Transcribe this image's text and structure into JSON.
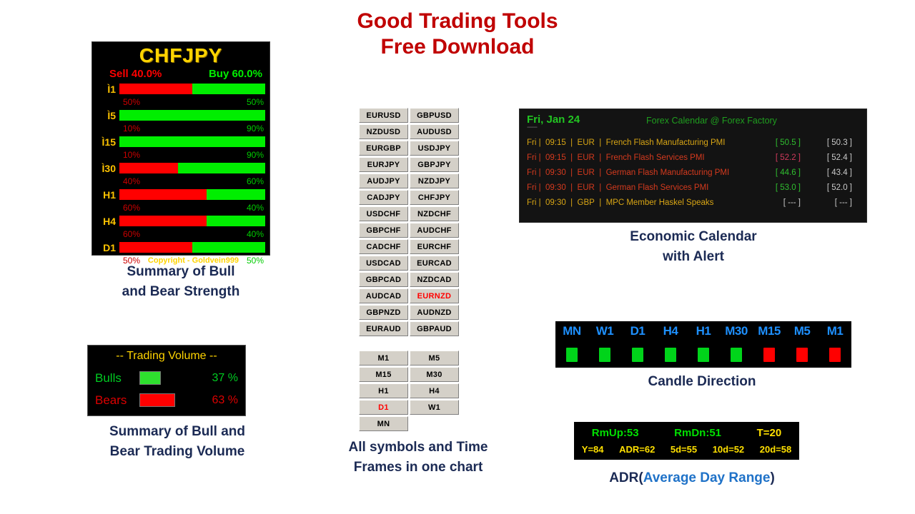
{
  "title": {
    "line1": "Good Trading Tools",
    "line2": "Free Download",
    "color": "#c00000"
  },
  "strength_panel": {
    "symbol": "CHFJPY",
    "sell_header": "Sell 40.0%",
    "buy_header": "Buy 60.0%",
    "copyright": "Copyright - Goldvein999",
    "sell_color": "#ff0000",
    "buy_color": "#00ee00",
    "rows": [
      {
        "timeframe": "Ì1",
        "sell_pct": "50%",
        "buy_pct": "50%",
        "sell_width": 50,
        "buy_width": 50
      },
      {
        "timeframe": "Ì5",
        "sell_pct": "10%",
        "buy_pct": "90%",
        "sell_width": 0,
        "buy_width": 100
      },
      {
        "timeframe": "Ì15",
        "sell_pct": "10%",
        "buy_pct": "90%",
        "sell_width": 0,
        "buy_width": 100
      },
      {
        "timeframe": "Ì30",
        "sell_pct": "40%",
        "buy_pct": "60%",
        "sell_width": 40,
        "buy_width": 60
      },
      {
        "timeframe": "H1",
        "sell_pct": "60%",
        "buy_pct": "40%",
        "sell_width": 60,
        "buy_width": 40
      },
      {
        "timeframe": "H4",
        "sell_pct": "60%",
        "buy_pct": "40%",
        "sell_width": 60,
        "buy_width": 40
      },
      {
        "timeframe": "D1",
        "sell_pct": "50%",
        "buy_pct": "50%",
        "sell_width": 50,
        "buy_width": 50
      }
    ],
    "footer_left": "50%",
    "footer_right": "50%",
    "caption_line1": "Summary of Bull",
    "caption_line2": "and Bear Strength"
  },
  "volume_panel": {
    "title": "-- Trading Volume --",
    "bulls_label": "Bulls",
    "bulls_pct": "37 %",
    "bulls_bar_width": 37,
    "bulls_color": "#2ee02e",
    "bears_label": "Bears",
    "bears_pct": "63 %",
    "bears_bar_width": 63,
    "bears_color": "#ff0000",
    "caption_line1": "Summary of Bull and",
    "caption_line2": "Bear Trading Volume"
  },
  "symbols_grid": {
    "rows": [
      [
        "EURUSD",
        "GBPUSD"
      ],
      [
        "NZDUSD",
        "AUDUSD"
      ],
      [
        "EURGBP",
        "USDJPY"
      ],
      [
        "EURJPY",
        "GBPJPY"
      ],
      [
        "AUDJPY",
        "NZDJPY"
      ],
      [
        "CADJPY",
        "CHFJPY"
      ],
      [
        "USDCHF",
        "NZDCHF"
      ],
      [
        "GBPCHF",
        "AUDCHF"
      ],
      [
        "CADCHF",
        "EURCHF"
      ],
      [
        "USDCAD",
        "EURCAD"
      ],
      [
        "GBPCAD",
        "NZDCAD"
      ],
      [
        "AUDCAD",
        "EURNZD"
      ],
      [
        "GBPNZD",
        "AUDNZD"
      ],
      [
        "EURAUD",
        "GBPAUD"
      ]
    ],
    "selected": "EURNZD",
    "selected_color": "#ff0000"
  },
  "timeframes_grid": {
    "rows": [
      [
        "M1",
        "M5"
      ],
      [
        "M15",
        "M30"
      ],
      [
        "H1",
        "H4"
      ],
      [
        "D1",
        "W1"
      ],
      [
        "MN",
        ""
      ]
    ],
    "selected": "D1",
    "caption_line1": "All symbols and Time",
    "caption_line2": "Frames in one chart"
  },
  "calendar_panel": {
    "date": "Fri, Jan 24",
    "source": "Forex Calendar @ Forex Factory",
    "divider": "------",
    "rows": [
      {
        "day": "Fri",
        "time": "09:15",
        "currency": "EUR",
        "event": "French Flash Manufacturing PMI",
        "actual": "[ 50.5 ]",
        "forecast": "[ 50.3 ]",
        "row_color": "amber",
        "actual_color": "green"
      },
      {
        "day": "Fri",
        "time": "09:15",
        "currency": "EUR",
        "event": "French Flash Services PMI",
        "actual": "[ 52.2 ]",
        "forecast": "[ 52.4 ]",
        "row_color": "red",
        "actual_color": "pink"
      },
      {
        "day": "Fri",
        "time": "09:30",
        "currency": "EUR",
        "event": "German Flash Manufacturing PMI",
        "actual": "[ 44.6 ]",
        "forecast": "[ 43.4 ]",
        "row_color": "red",
        "actual_color": "green"
      },
      {
        "day": "Fri",
        "time": "09:30",
        "currency": "EUR",
        "event": "German Flash Services PMI",
        "actual": "[ 53.0 ]",
        "forecast": "[ 52.0 ]",
        "row_color": "red",
        "actual_color": "green"
      },
      {
        "day": "Fri",
        "time": "09:30",
        "currency": "GBP",
        "event": "MPC Member Haskel Speaks",
        "actual": "[ --- ]",
        "forecast": "[ --- ]",
        "row_color": "amber",
        "actual_color": "grey"
      }
    ],
    "caption_line1": "Economic Calendar",
    "caption_line2": "with Alert"
  },
  "candle_panel": {
    "items": [
      {
        "timeframe": "MN",
        "direction": "up"
      },
      {
        "timeframe": "W1",
        "direction": "up"
      },
      {
        "timeframe": "D1",
        "direction": "up"
      },
      {
        "timeframe": "H4",
        "direction": "up"
      },
      {
        "timeframe": "H1",
        "direction": "up"
      },
      {
        "timeframe": "M30",
        "direction": "up"
      },
      {
        "timeframe": "M15",
        "direction": "down"
      },
      {
        "timeframe": "M5",
        "direction": "down"
      },
      {
        "timeframe": "M1",
        "direction": "down"
      }
    ],
    "up_color": "#00d41a",
    "down_color": "#ff0000",
    "label_color": "#1e90ff",
    "caption": "Candle Direction"
  },
  "adr_panel": {
    "rm_up": "RmUp:53",
    "rm_dn": "RmDn:51",
    "t": "T=20",
    "y": "Y=84",
    "adr": "ADR=62",
    "d5": "5d=55",
    "d10": "10d=52",
    "d20": "20d=58",
    "caption_prefix": "ADR(",
    "caption_accent": "Average Day Range",
    "caption_suffix": ")"
  }
}
